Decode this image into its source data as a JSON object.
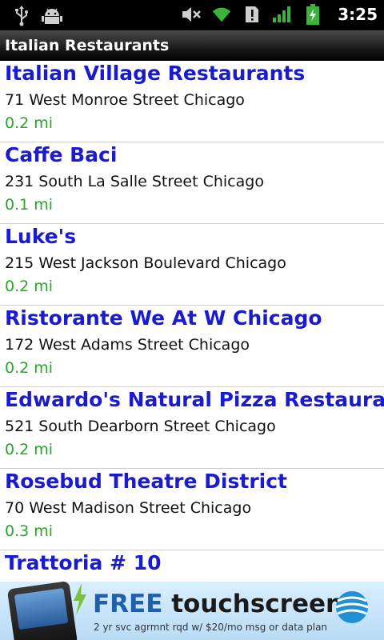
{
  "status_bar": {
    "time": "3:25",
    "icons": [
      "usb-icon",
      "android-debug-icon",
      "mute-icon",
      "wifi-icon",
      "alert-icon",
      "signal-icon",
      "battery-charging-icon"
    ]
  },
  "title_bar": {
    "title": "Italian Restaurants"
  },
  "restaurants": [
    {
      "name": "Italian Village Restaurants",
      "address": "71 West Monroe Street Chicago",
      "distance": "0.2 mi"
    },
    {
      "name": "Caffe Baci",
      "address": "231 South La Salle Street Chicago",
      "distance": "0.1 mi"
    },
    {
      "name": "Luke's",
      "address": "215 West Jackson Boulevard Chicago",
      "distance": "0.2 mi"
    },
    {
      "name": "Ristorante We At W Chicago",
      "address": "172 West Adams Street Chicago",
      "distance": "0.2 mi"
    },
    {
      "name": "Edwardo's Natural Pizza Restaurant",
      "address": "521 South Dearborn Street Chicago",
      "distance": "0.2 mi"
    },
    {
      "name": "Rosebud Theatre District",
      "address": "70 West Madison Street Chicago",
      "distance": "0.3 mi"
    },
    {
      "name": "Trattoria # 10",
      "address": "",
      "distance": ""
    }
  ],
  "ad": {
    "headline_free": "FREE",
    "headline_rest": " touchscreen",
    "subtext": "2 yr svc agrmnt rqd w/ $20/mo msg or data plan"
  },
  "colors": {
    "name": "#1a1acf",
    "distance": "#2aa52a",
    "title_bar": "#000000"
  }
}
